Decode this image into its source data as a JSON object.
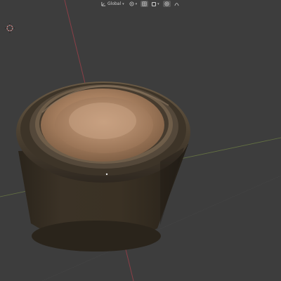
{
  "header": {
    "transform_orientation": {
      "label": "Global",
      "icon": "transform-orientation-icon",
      "dropdown_icon": "chevron-down-icon"
    },
    "pivot_icon": "pivot-point-icon",
    "snap_icon": "snap-icon",
    "snap_target_icon": "snap-target-icon",
    "proportional_edit_icon": "proportional-edit-icon",
    "falloff_icon": "falloff-curve-icon"
  },
  "viewport": {
    "cursor_icon": "3d-cursor-icon",
    "object": "bottle-cap-mesh",
    "colors": {
      "background": "#3d3d3d",
      "x_axis": "#8a3f47",
      "y_axis": "#6d7f3f",
      "grid": "#474747",
      "object_body": "#3a3124",
      "object_inner": "#b08666"
    }
  }
}
